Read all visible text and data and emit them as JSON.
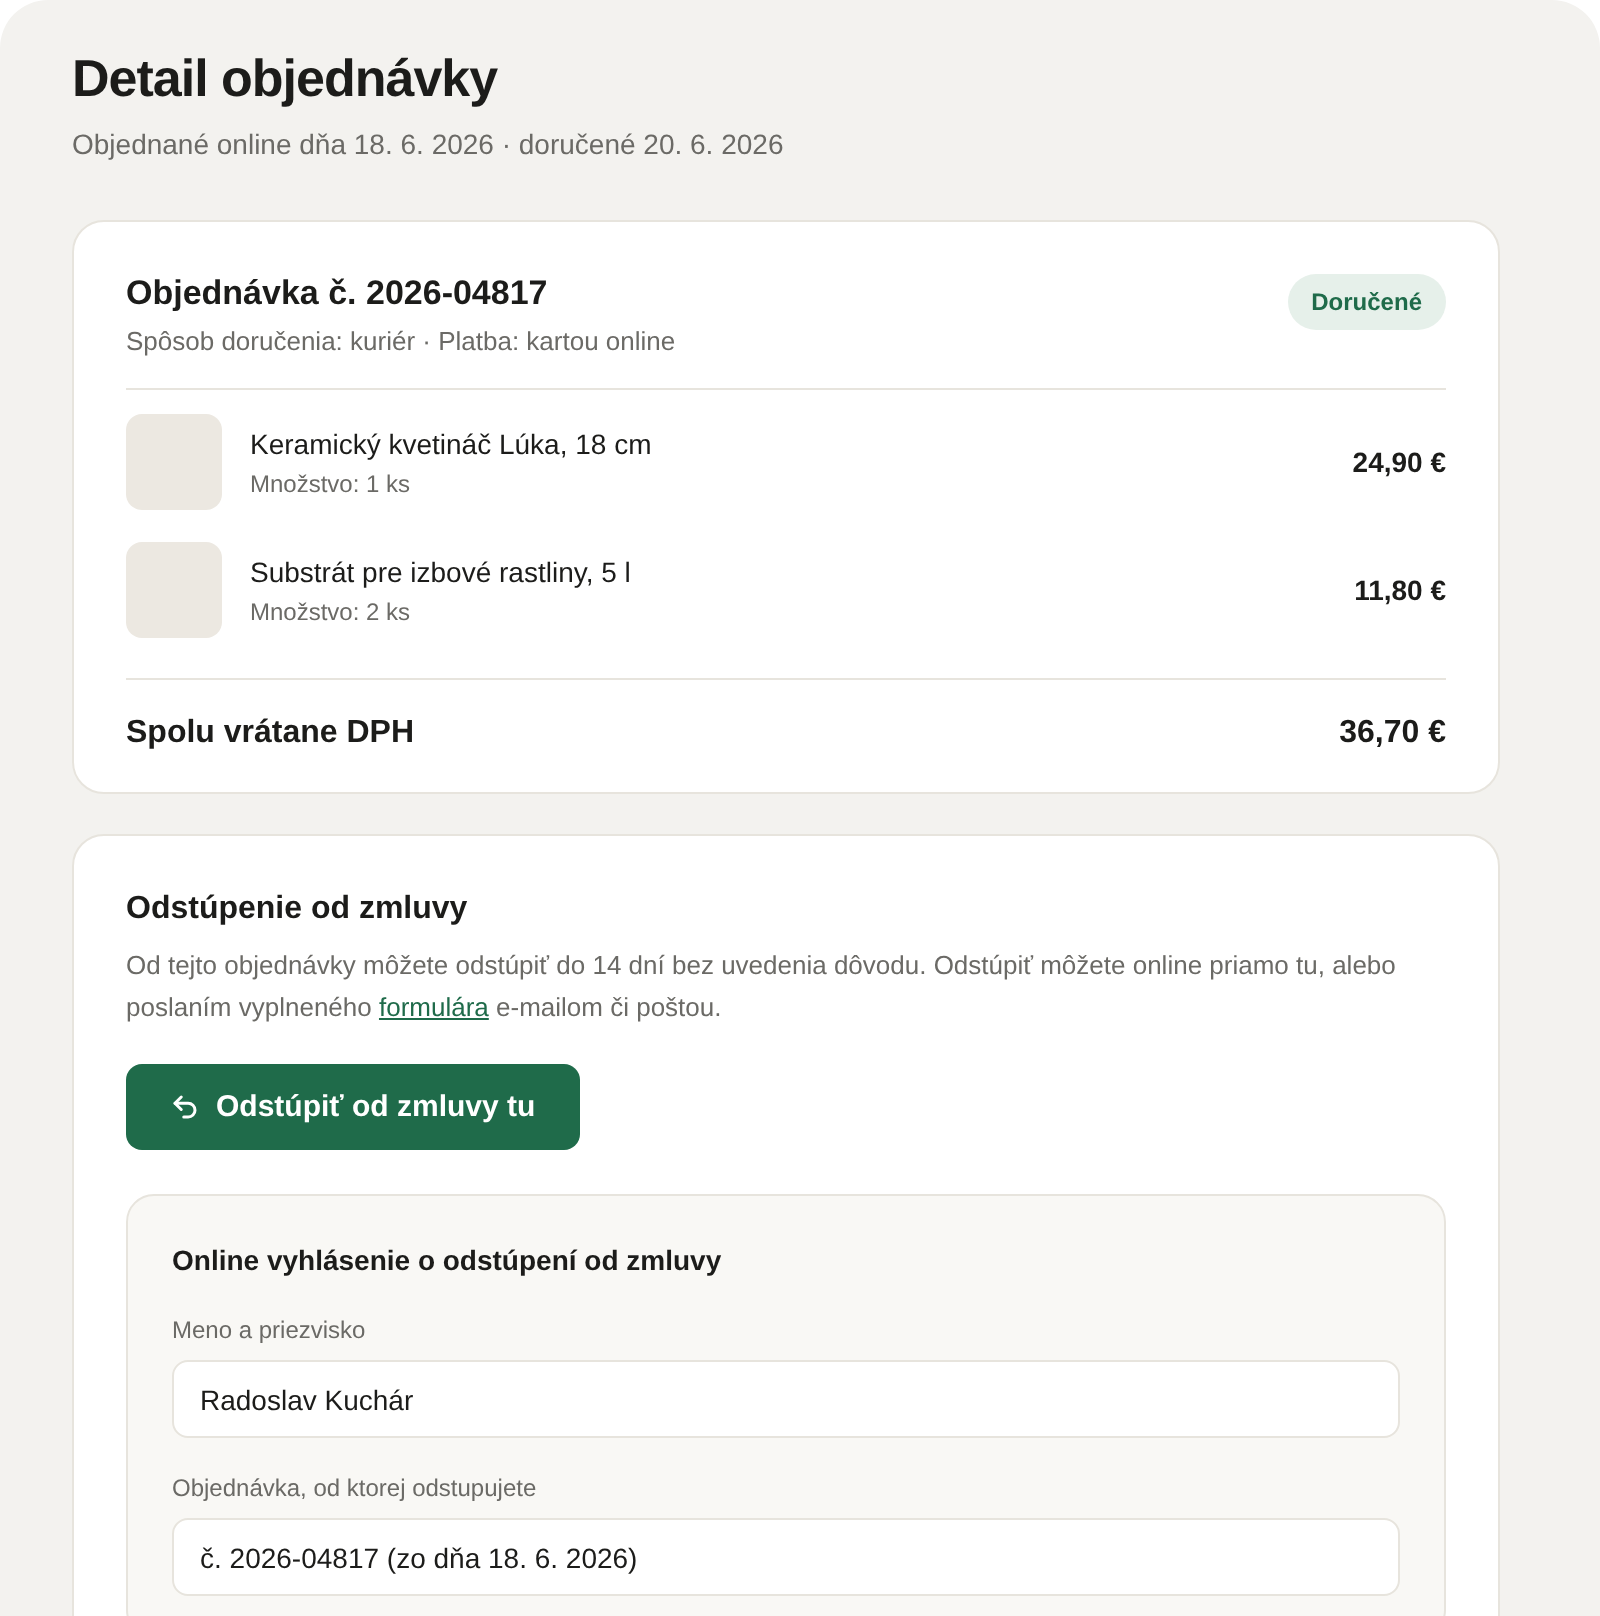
{
  "page": {
    "title": "Detail objednávky",
    "subtitle": "Objednané online dňa 18. 6. 2026 · doručené 20. 6. 2026"
  },
  "order": {
    "title": "Objednávka č. 2026-04817",
    "meta": "Spôsob doručenia: kuriér · Platba: kartou online",
    "status": "Doručené",
    "items": [
      {
        "name": "Keramický kvetináč Lúka, 18 cm",
        "quantity": "Množstvo: 1 ks",
        "price": "24,90 €"
      },
      {
        "name": "Substrát pre izbové rastliny, 5 l",
        "quantity": "Množstvo: 2 ks",
        "price": "11,80 €"
      }
    ],
    "total_label": "Spolu vrátane DPH",
    "total": "36,70 €"
  },
  "withdrawal": {
    "title": "Odstúpenie od zmluvy",
    "text_before": "Od tejto objednávky môžete odstúpiť do 14 dní bez uvedenia dôvodu. Odstúpiť môžete online priamo tu, alebo poslaním vyplneného ",
    "link": "formulára",
    "text_after": " e-mailom či poštou.",
    "button": "Odstúpiť od zmluvy tu",
    "form": {
      "title": "Online vyhlásenie o odstúpení od zmluvy",
      "fields": [
        {
          "label": "Meno a priezvisko",
          "value": "Radoslav Kuchár"
        },
        {
          "label": "Objednávka, od ktorej odstupujete",
          "value": "č. 2026-04817 (zo dňa 18. 6. 2026)"
        }
      ]
    }
  }
}
